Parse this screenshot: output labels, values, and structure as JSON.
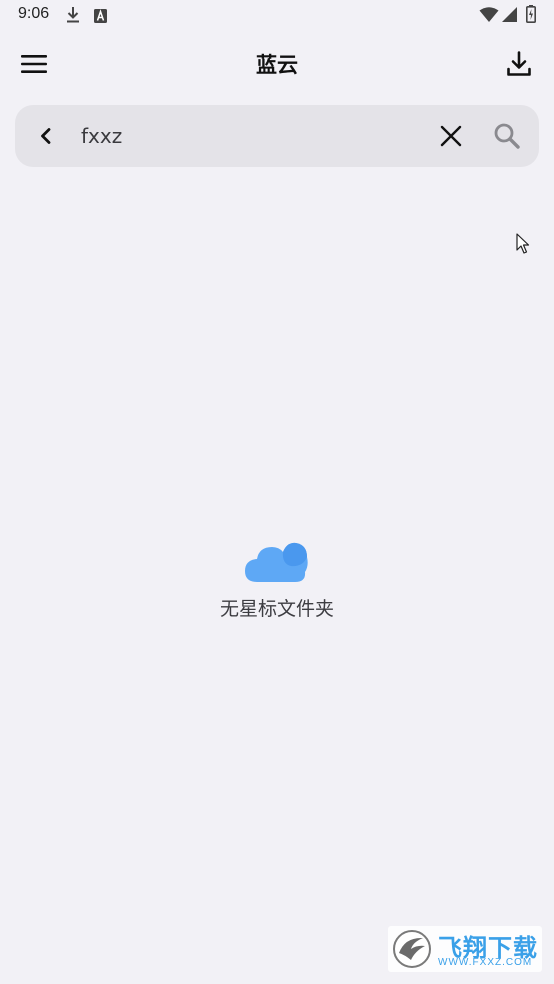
{
  "status_bar": {
    "time": "9:06",
    "icons": [
      "download-icon",
      "font-a-icon",
      "wifi-icon",
      "cell-signal-icon",
      "battery-icon"
    ]
  },
  "app_bar": {
    "title": "蓝云",
    "left_icon": "menu-icon",
    "right_icon": "download-icon"
  },
  "search": {
    "value": "fxxz",
    "back_icon": "back-icon",
    "clear_icon": "close-icon",
    "search_icon": "search-icon"
  },
  "empty_state": {
    "icon": "cloud-icon",
    "text": "无星标文件夹",
    "accent": "#5ea8f5"
  },
  "watermark": {
    "title": "飞翔下载",
    "url": "WWW.FXXZ.COM",
    "color": "#3aa0e8"
  }
}
